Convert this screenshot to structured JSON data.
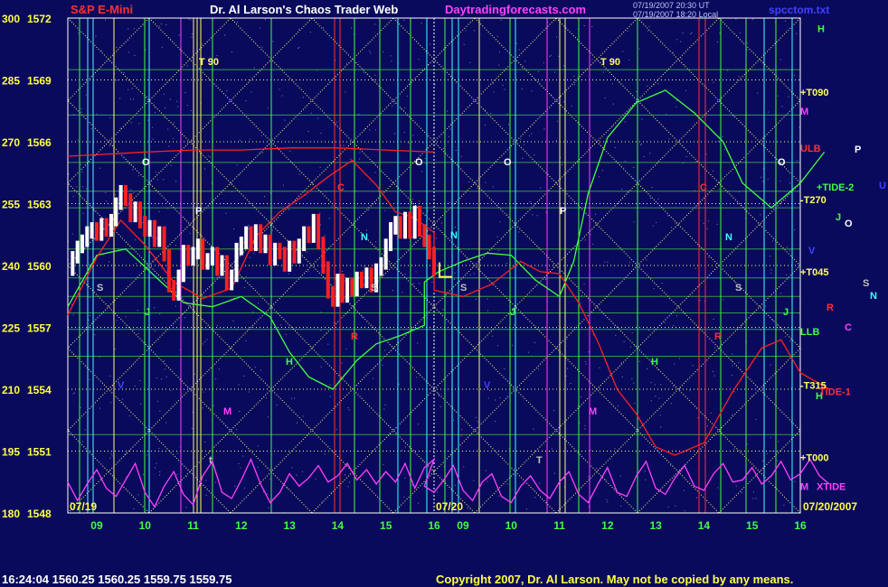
{
  "header": {
    "symbol": "S&P E-Mini",
    "site_title": "Dr. Al Larson's Chaos Trader Web",
    "website": "Daytradingforecasts.com",
    "timestamp_1": "07/19/2007 20:30 UT",
    "timestamp_2": "07/19/2007 18:20 Local",
    "filename": "spcctom.txt"
  },
  "footer": {
    "quote": "16:24:04  1560.25 1560.25 1559.75 1559.75",
    "copyright": "Copyright 2007, Dr. Al Larson. May not be copied by any means."
  },
  "colors": {
    "background": "#0a0a5c",
    "price_up": "#ffffff",
    "price_down": "#ff2020",
    "grid": "#40ff40",
    "diagonal": "#ffff80",
    "tide": "#ff40ff",
    "red_line": "#ff2020",
    "green_line": "#40ff40"
  },
  "chart_data": {
    "type": "line",
    "y_left_outer": [
      "300",
      "285",
      "270",
      "255",
      "240",
      "225",
      "210",
      "195",
      "180"
    ],
    "y_left_inner": [
      "1572",
      "1569",
      "1566",
      "1563",
      "1560",
      "1557",
      "1554",
      "1551",
      "1548"
    ],
    "ylim": [
      1548,
      1572
    ],
    "x_ticks_day1": [
      "09",
      "10",
      "11",
      "12",
      "13",
      "14",
      "15",
      "16"
    ],
    "x_ticks_day2": [
      "09",
      "10",
      "11",
      "12",
      "13",
      "14",
      "15",
      "16"
    ],
    "date_label_1": "07/19",
    "date_label_2": "07/20",
    "date_label_right": "07/20/2007",
    "right_labels": [
      {
        "text": "H",
        "price": 1571.5,
        "color": "#40ff40"
      },
      {
        "text": "+T090",
        "price": 1568.4,
        "color": "#ffff60"
      },
      {
        "text": "M",
        "price": 1567.5,
        "color": "#ff40ff"
      },
      {
        "text": "ULB",
        "price": 1565.7,
        "color": "#ff3030"
      },
      {
        "text": "+TIDE-2",
        "price": 1563.8,
        "color": "#40ff40"
      },
      {
        "text": "-T270",
        "price": 1563.2,
        "color": "#ffff60"
      },
      {
        "text": "+T045",
        "price": 1559.7,
        "color": "#ffff60"
      },
      {
        "text": "LLB",
        "price": 1556.8,
        "color": "#40ff40"
      },
      {
        "text": "-T315",
        "price": 1554.2,
        "color": "#ffff60"
      },
      {
        "text": "H",
        "price": 1553.7,
        "color": "#40ff40"
      },
      {
        "text": "TIDE-1",
        "price": 1553.9,
        "color": "#ff3030"
      },
      {
        "text": "+T000",
        "price": 1550.7,
        "color": "#ffff60"
      },
      {
        "text": "M",
        "price": 1549.3,
        "color": "#ff40ff"
      },
      {
        "text": "XTIDE",
        "price": 1549.3,
        "color": "#ff40ff"
      }
    ],
    "planet_labels": [
      {
        "text": "P",
        "x": 945,
        "y": 169,
        "color": "#ffffff"
      },
      {
        "text": "U",
        "x": 972,
        "y": 209,
        "color": "#4040ff"
      },
      {
        "text": "J",
        "x": 924,
        "y": 244,
        "color": "#40ff40"
      },
      {
        "text": "O",
        "x": 934,
        "y": 251,
        "color": "#ffffff"
      },
      {
        "text": "V",
        "x": 894,
        "y": 281,
        "color": "#4040ff"
      },
      {
        "text": "S",
        "x": 954,
        "y": 317,
        "color": "#c0c0c0"
      },
      {
        "text": "N",
        "x": 962,
        "y": 331,
        "color": "#40ffff"
      },
      {
        "text": "R",
        "x": 914,
        "y": 344,
        "color": "#ff3030"
      },
      {
        "text": "C",
        "x": 934,
        "y": 366,
        "color": "#ff40ff"
      }
    ],
    "chart_labels": [
      {
        "text": "T 90",
        "x": 220,
        "y": 72,
        "color": "#ffff60"
      },
      {
        "text": "T 90",
        "x": 664,
        "y": 72,
        "color": "#ffff60"
      },
      {
        "text": "O",
        "x": 157,
        "y": 183,
        "color": "#ffffff"
      },
      {
        "text": "O",
        "x": 459,
        "y": 183,
        "color": "#ffffff"
      },
      {
        "text": "O",
        "x": 557,
        "y": 183,
        "color": "#ffffff"
      },
      {
        "text": "O",
        "x": 860,
        "y": 183,
        "color": "#ffffff"
      },
      {
        "text": "C",
        "x": 373,
        "y": 211,
        "color": "#ff3030"
      },
      {
        "text": "C",
        "x": 774,
        "y": 211,
        "color": "#ff3030"
      },
      {
        "text": "P",
        "x": 216,
        "y": 237,
        "color": "#ffffff"
      },
      {
        "text": "P",
        "x": 619,
        "y": 237,
        "color": "#ffffff"
      },
      {
        "text": "N",
        "x": 399,
        "y": 266,
        "color": "#40ffff"
      },
      {
        "text": "N",
        "x": 498,
        "y": 264,
        "color": "#40ffff"
      },
      {
        "text": "N",
        "x": 802,
        "y": 266,
        "color": "#40ffff"
      },
      {
        "text": "S",
        "x": 107,
        "y": 322,
        "color": "#c0c0c0"
      },
      {
        "text": "S",
        "x": 410,
        "y": 322,
        "color": "#c0c0c0"
      },
      {
        "text": "S",
        "x": 509,
        "y": 322,
        "color": "#c0c0c0"
      },
      {
        "text": "S",
        "x": 813,
        "y": 322,
        "color": "#c0c0c0"
      },
      {
        "text": "J",
        "x": 160,
        "y": 349,
        "color": "#40ff40"
      },
      {
        "text": "J",
        "x": 564,
        "y": 349,
        "color": "#40ff40"
      },
      {
        "text": "J",
        "x": 866,
        "y": 349,
        "color": "#40ff40"
      },
      {
        "text": "R",
        "x": 388,
        "y": 376,
        "color": "#ff3030"
      },
      {
        "text": "R",
        "x": 790,
        "y": 376,
        "color": "#ff3030"
      },
      {
        "text": "H",
        "x": 316,
        "y": 404,
        "color": "#40ff40"
      },
      {
        "text": "H",
        "x": 720,
        "y": 404,
        "color": "#40ff40"
      },
      {
        "text": "V",
        "x": 130,
        "y": 430,
        "color": "#4040ff"
      },
      {
        "text": "V",
        "x": 535,
        "y": 430,
        "color": "#4040ff"
      },
      {
        "text": "M",
        "x": 247,
        "y": 459,
        "color": "#ff40ff"
      },
      {
        "text": "M",
        "x": 651,
        "y": 459,
        "color": "#ff40ff"
      },
      {
        "text": "t",
        "x": 231,
        "y": 513,
        "color": "#c0c0c0"
      },
      {
        "text": "T",
        "x": 593,
        "y": 513,
        "color": "#c0c0c0"
      }
    ],
    "price_series": {
      "name": "",
      "x": [
        8.4,
        8.5,
        8.6,
        8.7,
        8.8,
        8.9,
        9.0,
        9.1,
        9.2,
        9.3,
        9.4,
        9.5,
        9.6,
        9.7,
        9.8,
        9.9,
        10.0,
        10.1,
        10.2,
        10.3,
        10.4,
        10.5,
        10.6,
        10.7,
        10.8,
        10.9,
        11.0,
        11.1,
        11.2,
        11.3,
        11.4,
        11.5,
        11.6,
        11.7,
        11.8,
        11.9,
        12.0,
        12.1,
        12.2,
        12.3,
        12.4,
        12.5,
        12.6,
        12.7,
        12.8,
        12.9,
        13.0,
        13.1,
        13.2,
        13.3,
        13.4,
        13.5,
        13.6,
        13.7,
        13.8,
        13.9,
        14.0,
        14.1,
        14.2,
        14.3,
        14.4,
        14.5,
        14.6,
        14.7,
        14.8,
        14.9,
        15.0,
        15.1,
        15.2,
        15.3,
        15.4,
        15.5,
        15.6,
        15.7,
        15.8,
        15.9,
        16.0
      ],
      "values": [
        1559.8,
        1560.4,
        1560.9,
        1561.2,
        1561.6,
        1561.8,
        1561.5,
        1562.0,
        1561.7,
        1562.2,
        1563.0,
        1563.6,
        1563.2,
        1562.4,
        1562.8,
        1562.1,
        1561.7,
        1561.9,
        1561.2,
        1561.6,
        1560.5,
        1559.0,
        1558.6,
        1559.5,
        1560.7,
        1560.3,
        1560.6,
        1561.0,
        1560.1,
        1560.3,
        1560.6,
        1559.8,
        1560.2,
        1559.1,
        1559.5,
        1560.8,
        1561.1,
        1561.6,
        1561.0,
        1561.7,
        1560.9,
        1561.2,
        1560.3,
        1560.8,
        1560.6,
        1560.0,
        1560.9,
        1560.4,
        1561.0,
        1561.6,
        1561.4,
        1562.2,
        1561.1,
        1559.9,
        1558.7,
        1558.3,
        1559.3,
        1558.5,
        1559.1,
        1558.8,
        1559.4,
        1559.2,
        1559.6,
        1559.0,
        1559.8,
        1560.1,
        1561.0,
        1561.8,
        1562.1,
        1561.6,
        1562.3,
        1561.6,
        1562.6,
        1561.7,
        1561.2,
        1560.6,
        1559.8
      ]
    },
    "forecast_green": {
      "name": "",
      "x": [
        8.4,
        9.0,
        9.6,
        10.2,
        10.8,
        11.4,
        12.0,
        12.6,
        13.0,
        13.4,
        13.9,
        14.4,
        14.8,
        15.3,
        15.8,
        16.2,
        16.5,
        17.0,
        17.5,
        18.0,
        18.5,
        19.0,
        19.3,
        19.6,
        20.0,
        20.6,
        21.2,
        21.8,
        22.4,
        22.8,
        23.4,
        24.0,
        24.5
      ],
      "values": [
        1558.0,
        1560.5,
        1560.8,
        1559.5,
        1558.2,
        1558.0,
        1558.5,
        1557.5,
        1555.8,
        1554.6,
        1554.0,
        1555.4,
        1556.2,
        1556.6,
        1557.1,
        1559.2,
        1559.7,
        1560.2,
        1560.6,
        1560.5,
        1559.3,
        1558.5,
        1560.2,
        1563.5,
        1566.2,
        1567.9,
        1568.5,
        1567.4,
        1566.0,
        1564.0,
        1562.8,
        1564.0,
        1565.5
      ]
    },
    "forecast_red": {
      "name": "",
      "x": [
        8.4,
        9.0,
        9.5,
        10.0,
        10.6,
        11.2,
        11.8,
        12.3,
        12.8,
        13.3,
        13.8,
        14.3,
        14.8,
        15.2,
        15.6,
        16.0,
        16.4,
        17.0,
        17.6,
        18.2,
        18.6,
        19.0,
        19.4,
        19.8,
        20.2,
        20.6,
        21.0,
        21.4,
        22.0,
        22.6,
        23.2,
        23.6,
        24.0,
        24.6
      ],
      "values": [
        1557.6,
        1560.4,
        1562.2,
        1561.0,
        1559.2,
        1558.4,
        1558.9,
        1561.4,
        1562.6,
        1563.4,
        1564.3,
        1565.1,
        1563.9,
        1562.6,
        1562.3,
        1561.6,
        1558.8,
        1558.5,
        1559.1,
        1560.2,
        1559.7,
        1559.6,
        1558.2,
        1556.3,
        1554.0,
        1552.8,
        1551.2,
        1550.8,
        1551.4,
        1553.9,
        1556.0,
        1556.4,
        1554.8,
        1554.0
      ]
    },
    "upper_band": {
      "name": "",
      "x": [
        8.4,
        10.0,
        11.0,
        12.0,
        13.0,
        14.0,
        15.0,
        16.0
      ],
      "values": [
        1565.3,
        1565.5,
        1565.6,
        1565.6,
        1565.7,
        1565.7,
        1565.6,
        1565.5
      ]
    },
    "tide_series": {
      "name": "",
      "x": [
        8.4,
        8.6,
        8.8,
        9.0,
        9.2,
        9.4,
        9.6,
        9.8,
        10.0,
        10.2,
        10.4,
        10.6,
        10.8,
        11.0,
        11.2,
        11.4,
        11.6,
        11.8,
        12.0,
        12.2,
        12.4,
        12.6,
        12.8,
        13.0,
        13.2,
        13.4,
        13.6,
        13.8,
        14.0,
        14.2,
        14.4,
        14.6,
        14.8,
        15.0,
        15.2,
        15.4,
        15.6,
        15.8,
        16.0,
        16.2,
        16.4,
        16.6,
        16.8,
        17.0,
        17.2,
        17.4,
        17.6,
        17.8,
        18.0,
        18.2,
        18.4,
        18.6,
        18.8,
        19.0,
        19.2,
        19.4,
        19.6,
        19.8,
        20.0,
        20.2,
        20.4,
        20.6,
        20.8,
        21.0,
        21.2,
        21.4,
        21.6,
        21.8,
        22.0,
        22.2,
        22.4,
        22.6,
        22.8,
        23.0,
        23.2,
        23.4,
        23.6,
        23.8,
        24.0,
        24.2,
        24.4,
        24.6
      ],
      "values": [
        1549.5,
        1548.6,
        1549.4,
        1550.1,
        1549.2,
        1548.8,
        1549.6,
        1550.4,
        1549.0,
        1548.3,
        1549.3,
        1550.0,
        1548.9,
        1548.4,
        1549.8,
        1550.5,
        1549.0,
        1548.7,
        1549.6,
        1550.6,
        1549.4,
        1548.5,
        1549.0,
        1549.9,
        1549.3,
        1549.7,
        1550.3,
        1549.5,
        1549.8,
        1550.4,
        1549.6,
        1550.1,
        1549.4,
        1550.0,
        1549.5,
        1550.4,
        1549.2,
        1550.2,
        1550.6,
        1549.3,
        1549.0,
        1549.6,
        1550.3,
        1549.1,
        1548.6,
        1549.5,
        1549.9,
        1548.8,
        1548.5,
        1549.3,
        1549.8,
        1549.1,
        1548.7,
        1549.5,
        1550.0,
        1548.9,
        1548.5,
        1549.4,
        1550.2,
        1549.0,
        1548.8,
        1549.8,
        1550.5,
        1549.2,
        1548.9,
        1549.7,
        1550.3,
        1549.3,
        1549.1,
        1549.9,
        1550.4,
        1549.5,
        1549.6,
        1550.2,
        1549.4,
        1549.8,
        1550.5,
        1549.6,
        1549.9,
        1550.6,
        1549.8,
        1549.4
      ]
    }
  }
}
